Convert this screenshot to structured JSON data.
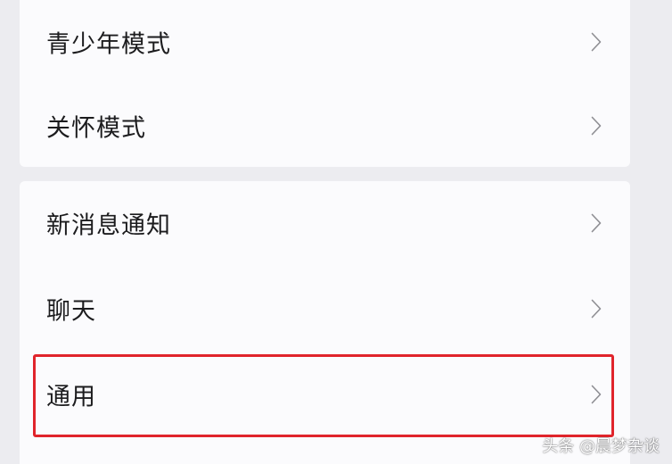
{
  "settings": {
    "groups": [
      {
        "items": [
          {
            "label": "青少年模式",
            "chevron": "chevron-right-icon"
          },
          {
            "label": "关怀模式",
            "chevron": "chevron-right-icon"
          }
        ]
      },
      {
        "items": [
          {
            "label": "新消息通知",
            "chevron": "chevron-right-icon"
          },
          {
            "label": "聊天",
            "chevron": "chevron-right-icon"
          },
          {
            "label": "通用",
            "chevron": "chevron-right-icon",
            "highlighted": true
          }
        ]
      }
    ]
  },
  "annotation": {
    "highlight_color": "#e0242b"
  },
  "watermark": {
    "text": "头条 @晨梦杂谈"
  },
  "colors": {
    "page_background": "#ececf0",
    "card_background": "#fbfbfd",
    "label_text": "#1c1c1e",
    "chevron": "#8e8e93"
  }
}
